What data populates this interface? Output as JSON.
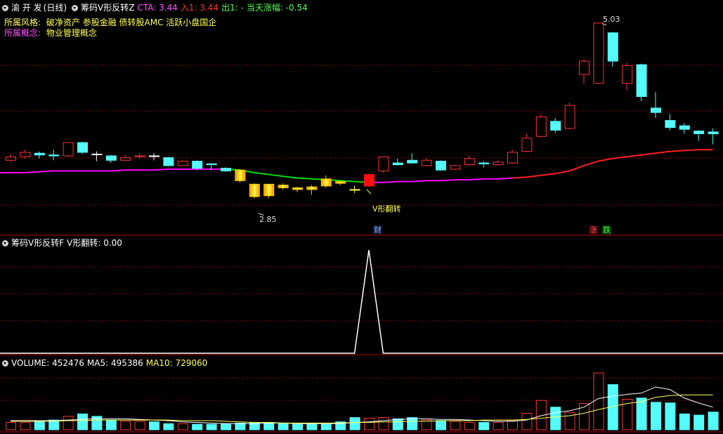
{
  "header": {
    "stock_name": "渝 开 发",
    "period": "(日线)",
    "indicator": "筹码V形反转Z",
    "cta_label": "CTA: 3.44",
    "in_label": "入1: 3.44",
    "out_label": "出1: -",
    "change_label": "当天涨幅: -0.54"
  },
  "info": {
    "style_label": "所属风格:",
    "style_value": "破净资产 参股金融 债转股AMC 活跃小盘国企",
    "concept_label": "所属概念:",
    "concept_value": "物业管理概念"
  },
  "annotations": {
    "high_value": "5.03",
    "low_value": "2.85",
    "signal": "V形翻转",
    "cai": "财",
    "zhang": "涨",
    "die": "跌"
  },
  "panel2": {
    "title": "筹码V形反转F",
    "value_label": "V形翻转: 0.00"
  },
  "panel3": {
    "title": "VOLUME: 452476",
    "ma5": "MA5: 495386",
    "ma10": "MA10: 729060"
  },
  "colors": {
    "up": "#ff3232",
    "down": "#54fcfc",
    "ma_magenta": "#ff00ff",
    "ma_green": "#00dd00",
    "ma_red": "#ff2020",
    "grid": "#8b0000",
    "yellow": "#ffff54"
  },
  "chart_data": {
    "type": "candlestick",
    "y_range": [
      2.8,
      5.1
    ],
    "candles": [
      {
        "o": 3.48,
        "c": 3.52,
        "h": 3.55,
        "l": 3.46,
        "dir": "up"
      },
      {
        "o": 3.52,
        "c": 3.57,
        "h": 3.6,
        "l": 3.5,
        "dir": "up"
      },
      {
        "o": 3.56,
        "c": 3.54,
        "h": 3.58,
        "l": 3.5,
        "dir": "down"
      },
      {
        "o": 3.54,
        "c": 3.53,
        "h": 3.6,
        "l": 3.48,
        "dir": "down"
      },
      {
        "o": 3.53,
        "c": 3.68,
        "h": 3.68,
        "l": 3.52,
        "dir": "up"
      },
      {
        "o": 3.68,
        "c": 3.57,
        "h": 3.69,
        "l": 3.55,
        "dir": "down"
      },
      {
        "o": 3.55,
        "c": 3.55,
        "h": 3.58,
        "l": 3.47,
        "dir": "flat"
      },
      {
        "o": 3.53,
        "c": 3.48,
        "h": 3.54,
        "l": 3.45,
        "dir": "down"
      },
      {
        "o": 3.48,
        "c": 3.51,
        "h": 3.54,
        "l": 3.47,
        "dir": "up"
      },
      {
        "o": 3.52,
        "c": 3.53,
        "h": 3.56,
        "l": 3.5,
        "dir": "up"
      },
      {
        "o": 3.53,
        "c": 3.53,
        "h": 3.56,
        "l": 3.48,
        "dir": "flat"
      },
      {
        "o": 3.51,
        "c": 3.42,
        "h": 3.52,
        "l": 3.41,
        "dir": "down"
      },
      {
        "o": 3.42,
        "c": 3.47,
        "h": 3.48,
        "l": 3.42,
        "dir": "up"
      },
      {
        "o": 3.47,
        "c": 3.39,
        "h": 3.48,
        "l": 3.37,
        "dir": "down"
      },
      {
        "o": 3.44,
        "c": 3.43,
        "h": 3.45,
        "l": 3.37,
        "dir": "down"
      },
      {
        "o": 3.39,
        "c": 3.36,
        "h": 3.4,
        "l": 3.35,
        "dir": "down"
      },
      {
        "o": 3.37,
        "c": 3.25,
        "h": 3.38,
        "l": 3.23,
        "dir": "yellow"
      },
      {
        "o": 3.21,
        "c": 3.07,
        "h": 3.22,
        "l": 3.05,
        "dir": "yellow"
      },
      {
        "o": 3.21,
        "c": 3.08,
        "h": 3.21,
        "l": 3.05,
        "dir": "yellow"
      },
      {
        "o": 3.2,
        "c": 3.17,
        "h": 3.22,
        "l": 3.15,
        "dir": "yellow"
      },
      {
        "o": 3.17,
        "c": 3.15,
        "h": 3.18,
        "l": 3.12,
        "dir": "yellow"
      },
      {
        "o": 3.18,
        "c": 3.15,
        "h": 3.2,
        "l": 3.09,
        "dir": "yellow"
      },
      {
        "o": 3.27,
        "c": 3.19,
        "h": 3.31,
        "l": 3.17,
        "dir": "yellow"
      },
      {
        "o": 3.24,
        "c": 3.22,
        "h": 3.25,
        "l": 3.2,
        "dir": "yellow"
      },
      {
        "o": 3.15,
        "c": 3.15,
        "h": 3.19,
        "l": 3.11,
        "dir": "flatyellow"
      },
      {
        "o": 3.19,
        "c": 3.32,
        "h": 3.32,
        "l": 3.18,
        "dir": "redsolid"
      },
      {
        "o": 3.36,
        "c": 3.52,
        "h": 3.52,
        "l": 3.34,
        "dir": "up"
      },
      {
        "o": 3.45,
        "c": 3.43,
        "h": 3.5,
        "l": 3.42,
        "dir": "down"
      },
      {
        "o": 3.48,
        "c": 3.45,
        "h": 3.56,
        "l": 3.44,
        "dir": "down"
      },
      {
        "o": 3.42,
        "c": 3.48,
        "h": 3.5,
        "l": 3.41,
        "dir": "up"
      },
      {
        "o": 3.47,
        "c": 3.37,
        "h": 3.48,
        "l": 3.36,
        "dir": "down"
      },
      {
        "o": 3.38,
        "c": 3.42,
        "h": 3.43,
        "l": 3.37,
        "dir": "up"
      },
      {
        "o": 3.43,
        "c": 3.5,
        "h": 3.53,
        "l": 3.42,
        "dir": "up"
      },
      {
        "o": 3.45,
        "c": 3.44,
        "h": 3.47,
        "l": 3.4,
        "dir": "down"
      },
      {
        "o": 3.43,
        "c": 3.46,
        "h": 3.48,
        "l": 3.42,
        "dir": "up"
      },
      {
        "o": 3.45,
        "c": 3.57,
        "h": 3.6,
        "l": 3.44,
        "dir": "up"
      },
      {
        "o": 3.58,
        "c": 3.73,
        "h": 3.78,
        "l": 3.57,
        "dir": "up"
      },
      {
        "o": 3.75,
        "c": 3.97,
        "h": 4.0,
        "l": 3.74,
        "dir": "up"
      },
      {
        "o": 3.92,
        "c": 3.82,
        "h": 3.96,
        "l": 3.79,
        "dir": "down"
      },
      {
        "o": 3.84,
        "c": 4.1,
        "h": 4.13,
        "l": 3.83,
        "dir": "up"
      },
      {
        "o": 4.45,
        "c": 4.6,
        "h": 4.62,
        "l": 4.34,
        "dir": "up"
      },
      {
        "o": 4.35,
        "c": 5.03,
        "h": 5.03,
        "l": 4.35,
        "dir": "up"
      },
      {
        "o": 4.92,
        "c": 4.6,
        "h": 4.93,
        "l": 4.54,
        "dir": "down"
      },
      {
        "o": 4.35,
        "c": 4.55,
        "h": 4.58,
        "l": 4.27,
        "dir": "up"
      },
      {
        "o": 4.56,
        "c": 4.2,
        "h": 4.57,
        "l": 4.15,
        "dir": "down"
      },
      {
        "o": 4.07,
        "c": 4.02,
        "h": 4.25,
        "l": 3.96,
        "dir": "down"
      },
      {
        "o": 3.93,
        "c": 3.85,
        "h": 4.0,
        "l": 3.82,
        "dir": "down"
      },
      {
        "o": 3.87,
        "c": 3.83,
        "h": 3.9,
        "l": 3.78,
        "dir": "down"
      },
      {
        "o": 3.81,
        "c": 3.78,
        "h": 3.82,
        "l": 3.7,
        "dir": "down"
      },
      {
        "o": 3.8,
        "c": 3.78,
        "h": 3.84,
        "l": 3.66,
        "dir": "down"
      }
    ],
    "ma_line": [
      3.34,
      3.34,
      3.35,
      3.36,
      3.36,
      3.36,
      3.36,
      3.36,
      3.37,
      3.37,
      3.37,
      3.38,
      3.38,
      3.38,
      3.38,
      3.38,
      3.37,
      3.34,
      3.32,
      3.3,
      3.28,
      3.27,
      3.26,
      3.25,
      3.24,
      3.23,
      3.23,
      3.24,
      3.24,
      3.25,
      3.25,
      3.26,
      3.26,
      3.27,
      3.27,
      3.28,
      3.29,
      3.31,
      3.33,
      3.36,
      3.42,
      3.47,
      3.5,
      3.52,
      3.54,
      3.56,
      3.58,
      3.59,
      3.6,
      3.6
    ],
    "signal": [
      0,
      0,
      0,
      0,
      0,
      0,
      0,
      0,
      0,
      0,
      0,
      0,
      0,
      0,
      0,
      0,
      0,
      0,
      0,
      0,
      0,
      0,
      0,
      0,
      0,
      1,
      0,
      0,
      0,
      0,
      0,
      0,
      0,
      0,
      0,
      0,
      0,
      0,
      0,
      0,
      0,
      0,
      0,
      0,
      0,
      0,
      0,
      0,
      0,
      0
    ],
    "volume": [
      0.12,
      0.12,
      0.13,
      0.16,
      0.22,
      0.26,
      0.22,
      0.16,
      0.14,
      0.14,
      0.13,
      0.1,
      0.1,
      0.09,
      0.09,
      0.1,
      0.11,
      0.12,
      0.12,
      0.1,
      0.09,
      0.1,
      0.09,
      0.13,
      0.2,
      0.19,
      0.2,
      0.18,
      0.2,
      0.16,
      0.15,
      0.14,
      0.12,
      0.12,
      0.12,
      0.15,
      0.27,
      0.48,
      0.37,
      0.28,
      0.43,
      0.93,
      0.74,
      0.5,
      0.52,
      0.45,
      0.44,
      0.26,
      0.24,
      0.29
    ],
    "ma5_vol": [
      0.15,
      0.15,
      0.15,
      0.15,
      0.16,
      0.17,
      0.18,
      0.18,
      0.18,
      0.17,
      0.16,
      0.15,
      0.13,
      0.12,
      0.11,
      0.1,
      0.1,
      0.1,
      0.11,
      0.11,
      0.1,
      0.1,
      0.1,
      0.1,
      0.12,
      0.13,
      0.15,
      0.17,
      0.18,
      0.18,
      0.17,
      0.17,
      0.16,
      0.15,
      0.14,
      0.14,
      0.16,
      0.23,
      0.28,
      0.31,
      0.37,
      0.51,
      0.55,
      0.58,
      0.6,
      0.7,
      0.66,
      0.52,
      0.44,
      0.37
    ],
    "ma10_vol": [
      0.14,
      0.14,
      0.14,
      0.14,
      0.15,
      0.15,
      0.16,
      0.16,
      0.16,
      0.16,
      0.16,
      0.16,
      0.15,
      0.15,
      0.15,
      0.14,
      0.13,
      0.12,
      0.12,
      0.11,
      0.11,
      0.11,
      0.11,
      0.11,
      0.12,
      0.12,
      0.13,
      0.13,
      0.14,
      0.14,
      0.15,
      0.15,
      0.15,
      0.16,
      0.16,
      0.16,
      0.17,
      0.19,
      0.21,
      0.23,
      0.27,
      0.33,
      0.38,
      0.43,
      0.46,
      0.53,
      0.56,
      0.57,
      0.57,
      0.57
    ]
  }
}
